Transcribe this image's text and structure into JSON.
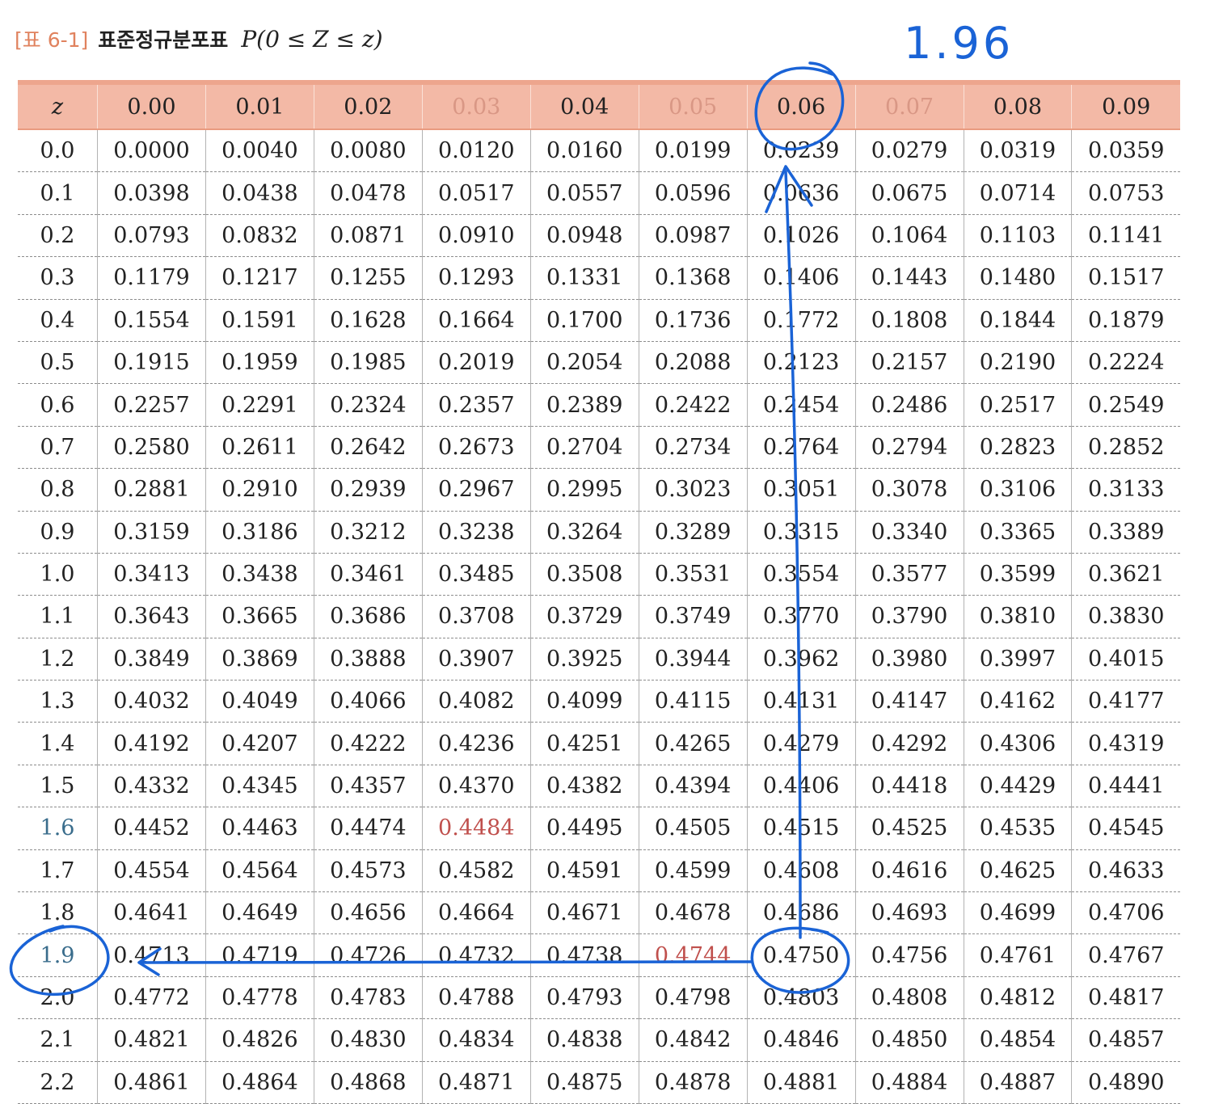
{
  "caption": {
    "label": "[표 6-1]",
    "title": "표준정규분포표",
    "formula": "P(0 ≤ Z ≤ z)"
  },
  "handwritten_note": "1.96",
  "table": {
    "headers": [
      "z",
      "0.00",
      "0.01",
      "0.02",
      "0.03",
      "0.04",
      "0.05",
      "0.06",
      "0.07",
      "0.08",
      "0.09"
    ],
    "rows": [
      [
        "0.0",
        "0.0000",
        "0.0040",
        "0.0080",
        "0.0120",
        "0.0160",
        "0.0199",
        "0.0239",
        "0.0279",
        "0.0319",
        "0.0359"
      ],
      [
        "0.1",
        "0.0398",
        "0.0438",
        "0.0478",
        "0.0517",
        "0.0557",
        "0.0596",
        "0.0636",
        "0.0675",
        "0.0714",
        "0.0753"
      ],
      [
        "0.2",
        "0.0793",
        "0.0832",
        "0.0871",
        "0.0910",
        "0.0948",
        "0.0987",
        "0.1026",
        "0.1064",
        "0.1103",
        "0.1141"
      ],
      [
        "0.3",
        "0.1179",
        "0.1217",
        "0.1255",
        "0.1293",
        "0.1331",
        "0.1368",
        "0.1406",
        "0.1443",
        "0.1480",
        "0.1517"
      ],
      [
        "0.4",
        "0.1554",
        "0.1591",
        "0.1628",
        "0.1664",
        "0.1700",
        "0.1736",
        "0.1772",
        "0.1808",
        "0.1844",
        "0.1879"
      ],
      [
        "0.5",
        "0.1915",
        "0.1959",
        "0.1985",
        "0.2019",
        "0.2054",
        "0.2088",
        "0.2123",
        "0.2157",
        "0.2190",
        "0.2224"
      ],
      [
        "0.6",
        "0.2257",
        "0.2291",
        "0.2324",
        "0.2357",
        "0.2389",
        "0.2422",
        "0.2454",
        "0.2486",
        "0.2517",
        "0.2549"
      ],
      [
        "0.7",
        "0.2580",
        "0.2611",
        "0.2642",
        "0.2673",
        "0.2704",
        "0.2734",
        "0.2764",
        "0.2794",
        "0.2823",
        "0.2852"
      ],
      [
        "0.8",
        "0.2881",
        "0.2910",
        "0.2939",
        "0.2967",
        "0.2995",
        "0.3023",
        "0.3051",
        "0.3078",
        "0.3106",
        "0.3133"
      ],
      [
        "0.9",
        "0.3159",
        "0.3186",
        "0.3212",
        "0.3238",
        "0.3264",
        "0.3289",
        "0.3315",
        "0.3340",
        "0.3365",
        "0.3389"
      ],
      [
        "1.0",
        "0.3413",
        "0.3438",
        "0.3461",
        "0.3485",
        "0.3508",
        "0.3531",
        "0.3554",
        "0.3577",
        "0.3599",
        "0.3621"
      ],
      [
        "1.1",
        "0.3643",
        "0.3665",
        "0.3686",
        "0.3708",
        "0.3729",
        "0.3749",
        "0.3770",
        "0.3790",
        "0.3810",
        "0.3830"
      ],
      [
        "1.2",
        "0.3849",
        "0.3869",
        "0.3888",
        "0.3907",
        "0.3925",
        "0.3944",
        "0.3962",
        "0.3980",
        "0.3997",
        "0.4015"
      ],
      [
        "1.3",
        "0.4032",
        "0.4049",
        "0.4066",
        "0.4082",
        "0.4099",
        "0.4115",
        "0.4131",
        "0.4147",
        "0.4162",
        "0.4177"
      ],
      [
        "1.4",
        "0.4192",
        "0.4207",
        "0.4222",
        "0.4236",
        "0.4251",
        "0.4265",
        "0.4279",
        "0.4292",
        "0.4306",
        "0.4319"
      ],
      [
        "1.5",
        "0.4332",
        "0.4345",
        "0.4357",
        "0.4370",
        "0.4382",
        "0.4394",
        "0.4406",
        "0.4418",
        "0.4429",
        "0.4441"
      ],
      [
        "1.6",
        "0.4452",
        "0.4463",
        "0.4474",
        "0.4484",
        "0.4495",
        "0.4505",
        "0.4515",
        "0.4525",
        "0.4535",
        "0.4545"
      ],
      [
        "1.7",
        "0.4554",
        "0.4564",
        "0.4573",
        "0.4582",
        "0.4591",
        "0.4599",
        "0.4608",
        "0.4616",
        "0.4625",
        "0.4633"
      ],
      [
        "1.8",
        "0.4641",
        "0.4649",
        "0.4656",
        "0.4664",
        "0.4671",
        "0.4678",
        "0.4686",
        "0.4693",
        "0.4699",
        "0.4706"
      ],
      [
        "1.9",
        "0.4713",
        "0.4719",
        "0.4726",
        "0.4732",
        "0.4738",
        "0.4744",
        "0.4750",
        "0.4756",
        "0.4761",
        "0.4767"
      ],
      [
        "2.0",
        "0.4772",
        "0.4778",
        "0.4783",
        "0.4788",
        "0.4793",
        "0.4798",
        "0.4803",
        "0.4808",
        "0.4812",
        "0.4817"
      ],
      [
        "2.1",
        "0.4821",
        "0.4826",
        "0.4830",
        "0.4834",
        "0.4838",
        "0.4842",
        "0.4846",
        "0.4850",
        "0.4854",
        "0.4857"
      ],
      [
        "2.2",
        "0.4861",
        "0.4864",
        "0.4868",
        "0.4871",
        "0.4875",
        "0.4878",
        "0.4881",
        "0.4884",
        "0.4887",
        "0.4890"
      ]
    ]
  },
  "highlights": {
    "red_cells": [
      [
        16,
        4
      ],
      [
        19,
        6
      ]
    ],
    "blue_row_labels": [
      16,
      19
    ],
    "faded_headers": [
      4,
      6,
      8
    ]
  },
  "annotation_color": "#1a63d6"
}
